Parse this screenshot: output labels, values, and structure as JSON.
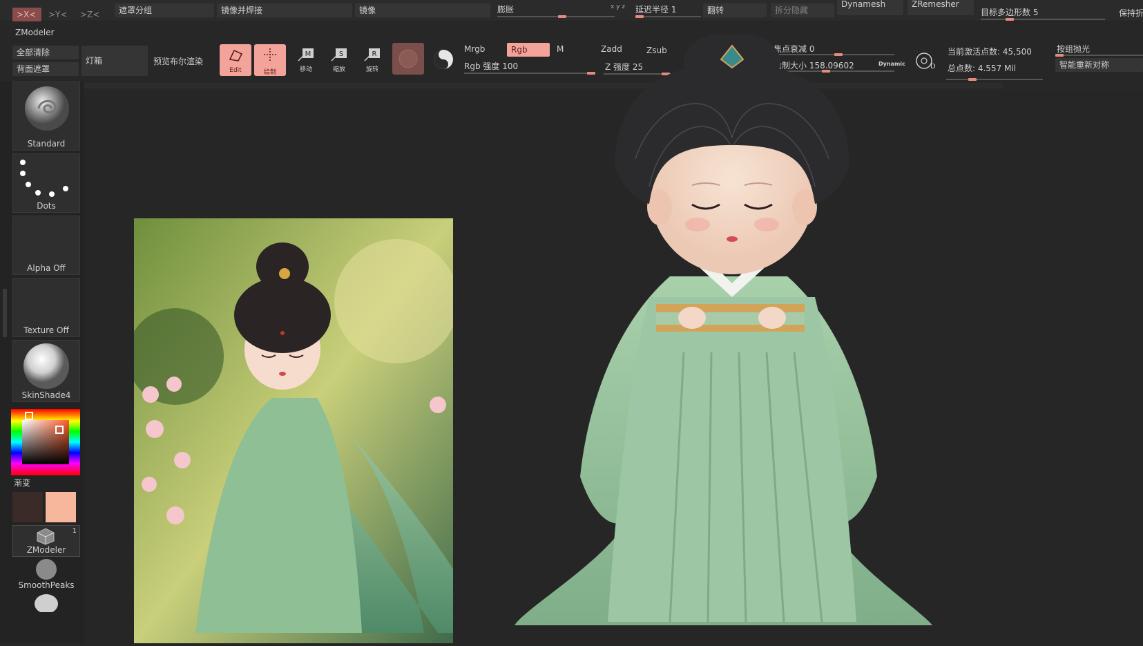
{
  "top": {
    "axis_x": ">X<",
    "axis_y": ">Y<",
    "axis_z": ">Z<",
    "mask_group": "遮罩分组",
    "mirror_weld": "镜像并焊接",
    "mirror": "镜像",
    "inflate": "膨胀",
    "xyz": "x y z",
    "lazy_radius": "延迟半径 1",
    "flip": "翻转",
    "split_hidden": "拆分隐藏",
    "dynamesh": "Dynamesh",
    "zremesher": "ZRemesher",
    "target_poly": "目标多边形数 5",
    "keep": "保持折"
  },
  "toolbar": {
    "tool_name": "ZModeler",
    "clear_all": "全部清除",
    "backface_mask": "背面遮罩",
    "lightbox": "灯箱",
    "bpr": "预览布尔渲染",
    "edit": "Edit",
    "draw": "绘制",
    "move": "移动",
    "scale": "缩放",
    "rotate": "旋转",
    "mrgb": "Mrgb",
    "rgb": "Rgb",
    "m": "M",
    "rgb_intensity": "Rgb 强度 100",
    "zadd": "Zadd",
    "zsub": "Zsub",
    "z_intensity": "Z 强度 25",
    "focal_shift": "焦点衰减 0",
    "draw_size": "绘制大小 158.09602",
    "dynamic": "Dynamic",
    "active_points": "当前激活点数: 45,500",
    "total_points": "总点数: 4.557 Mil",
    "polish_groups": "按组抛光",
    "smart_resym": "智能重新对称"
  },
  "left": {
    "brush1": "Standard",
    "brush2": "Dots",
    "alpha": "Alpha Off",
    "texture": "Texture Off",
    "material": "SkinShade4",
    "gradient": "渐变",
    "tool_label": "ZModeler",
    "tool_count": "1",
    "smooth": "SmoothPeaks"
  },
  "colors": {
    "accent": "#f4a39a",
    "primary_swatch": "#f6b79c",
    "secondary_swatch": "#3a2a28",
    "robe": "#9cc6a4"
  }
}
